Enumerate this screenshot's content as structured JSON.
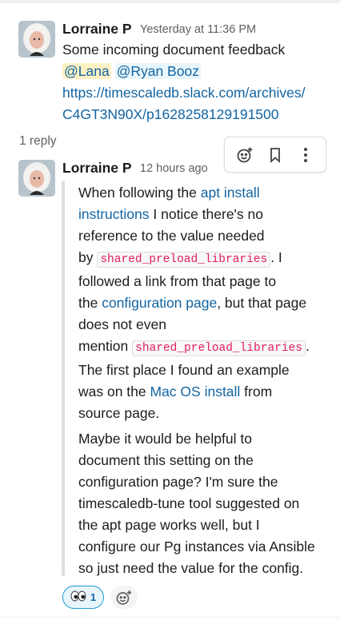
{
  "parent": {
    "author": "Lorraine P",
    "timestamp": "Yesterday at 11:36 PM",
    "text": "Some incoming document feedback",
    "mentions": [
      "@Lana",
      "@Ryan Booz"
    ],
    "link_line1": "https://timescaledb.slack.com/archives/",
    "link_line2": "C4GT3N90X/p1628258129191500"
  },
  "thread": {
    "reply_count": "1 reply"
  },
  "reply": {
    "author": "Lorraine P",
    "timestamp": "12 hours ago",
    "p1": {
      "t1": "When following the ",
      "link1a": "apt install",
      "link1b": "instructions",
      "t2": " I notice there's no",
      "t3": "reference to the value needed",
      "t4": "by ",
      "code1": "shared_preload_libraries",
      "t5": ".  I",
      "t6": "followed a link from that page to",
      "t7": "the ",
      "link2": "configuration page",
      "t8": ", but that page",
      "t9": "does not even",
      "t10": "mention ",
      "code2": "shared_preload_libraries",
      "t11": ".",
      "t12": "The first place I found an example",
      "t13": "was on the ",
      "link3": "Mac OS install",
      "t14": " from",
      "t15": "source page."
    },
    "p2": [
      "Maybe it would be helpful to",
      "document this setting on the",
      "configuration page?  I'm sure the",
      "timescaledb-tune tool suggested on",
      "the apt page works well, but I",
      "configure our Pg instances via Ansible",
      "so just need the value for the config."
    ]
  },
  "reactions": [
    {
      "icon": "eyes-emoji-icon",
      "count": "1"
    }
  ],
  "toolbar": {
    "icons": [
      "add-reaction-icon",
      "bookmark-icon",
      "more-actions-icon"
    ]
  }
}
